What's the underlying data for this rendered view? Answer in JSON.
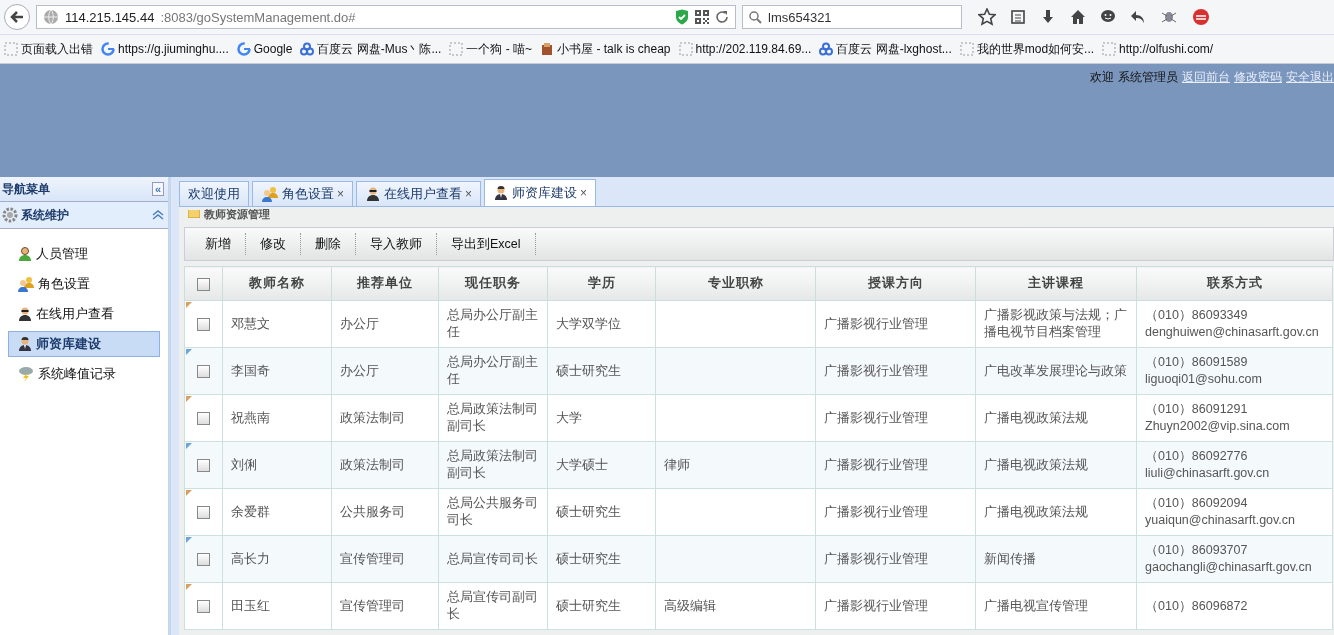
{
  "browser": {
    "url_host": "114.215.145.44",
    "url_path": ":8083/goSystemManagement.do#",
    "search_value": "lms654321",
    "bookmarks": [
      {
        "kind": "blank",
        "label": "页面载入出错"
      },
      {
        "kind": "google",
        "label": "https://g.jiuminghu...."
      },
      {
        "kind": "google",
        "label": "Google"
      },
      {
        "kind": "cloud",
        "label": "百度云 网盘-Mus丶陈..."
      },
      {
        "kind": "blank",
        "label": "一个狗 - 喵~"
      },
      {
        "kind": "book",
        "label": "小书屋 - talk is cheap"
      },
      {
        "kind": "blank",
        "label": "http://202.119.84.69..."
      },
      {
        "kind": "cloud",
        "label": "百度云 网盘-lxghost..."
      },
      {
        "kind": "blank",
        "label": "我的世界mod如何安..."
      },
      {
        "kind": "blank",
        "label": "http://olfushi.com/"
      }
    ]
  },
  "header": {
    "welcome": "欢迎",
    "user": "系统管理员",
    "links": [
      "返回前台",
      "修改密码",
      "安全退出"
    ]
  },
  "sidebar": {
    "title": "导航菜单",
    "collapse": "«",
    "section": {
      "title": "系统维护",
      "expanded": true
    },
    "items": [
      {
        "kind": "user",
        "label": "人员管理",
        "selected": false
      },
      {
        "kind": "users",
        "label": "角色设置",
        "selected": false
      },
      {
        "kind": "agent",
        "label": "在线用户查看",
        "selected": false
      },
      {
        "kind": "teacher",
        "label": "师资库建设",
        "selected": true
      },
      {
        "kind": "storm",
        "label": "系统峰值记录",
        "selected": false
      }
    ]
  },
  "tabs": [
    {
      "label": "欢迎使用",
      "kind": "plain",
      "selected": false
    },
    {
      "label": "角色设置",
      "kind": "users",
      "close": "×",
      "selected": false
    },
    {
      "label": "在线用户查看",
      "kind": "agent",
      "close": "×",
      "selected": false
    },
    {
      "label": "师资库建设",
      "kind": "teacher",
      "close": "×",
      "selected": true
    }
  ],
  "panel_title": "教师资源管理",
  "toolbar": [
    "新增",
    "修改",
    "删除",
    "导入教师",
    "导出到Excel"
  ],
  "table": {
    "columns": [
      "教师名称",
      "推荐单位",
      "现任职务",
      "学历",
      "专业职称",
      "授课方向",
      "主讲课程",
      "联系方式"
    ],
    "header_checked": false,
    "rows": [
      {
        "checked": false,
        "cells": [
          "邓慧文",
          "办公厅",
          "总局办公厅副主任",
          "大学双学位",
          "",
          "广播影视行业管理",
          "广播影视政策与法规；广播电视节目档案管理"
        ],
        "phone": "（010）86093349",
        "email": "denghuiwen@chinasarft.gov.cn"
      },
      {
        "checked": false,
        "cells": [
          "李国奇",
          "办公厅",
          "总局办公厅副主任",
          "硕士研究生",
          "",
          "广播影视行业管理",
          "广电改革发展理论与政策"
        ],
        "phone": "（010）86091589",
        "email": "liguoqi01@sohu.com"
      },
      {
        "checked": false,
        "cells": [
          "祝燕南",
          "政策法制司",
          "总局政策法制司副司长",
          "大学",
          "",
          "广播影视行业管理",
          "广播电视政策法规"
        ],
        "phone": "（010）86091291",
        "email": "Zhuyn2002@vip.sina.com"
      },
      {
        "checked": false,
        "cells": [
          "刘俐",
          "政策法制司",
          "总局政策法制司副司长",
          "大学硕士",
          "律师",
          "广播影视行业管理",
          "广播电视政策法规"
        ],
        "phone": "（010）86092776",
        "email": "liuli@chinasarft.gov.cn"
      },
      {
        "checked": false,
        "cells": [
          "余爱群",
          "公共服务司",
          "总局公共服务司司长",
          "硕士研究生",
          "",
          "广播影视行业管理",
          "广播电视政策法规"
        ],
        "phone": "（010）86092094",
        "email": "yuaiqun@chinasarft.gov.cn"
      },
      {
        "checked": false,
        "cells": [
          "高长力",
          "宣传管理司",
          "总局宣传司司长",
          "硕士研究生",
          "",
          "广播影视行业管理",
          "新闻传播"
        ],
        "phone": "（010）86093707",
        "email": "gaochangli@chinasarft.gov.cn"
      },
      {
        "checked": false,
        "cells": [
          "田玉红",
          "宣传管理司",
          "总局宣传司副司长",
          "硕士研究生",
          "高级编辑",
          "广播影视行业管理",
          "广播电视宣传管理"
        ],
        "phone": "（010）86096872"
      }
    ]
  }
}
